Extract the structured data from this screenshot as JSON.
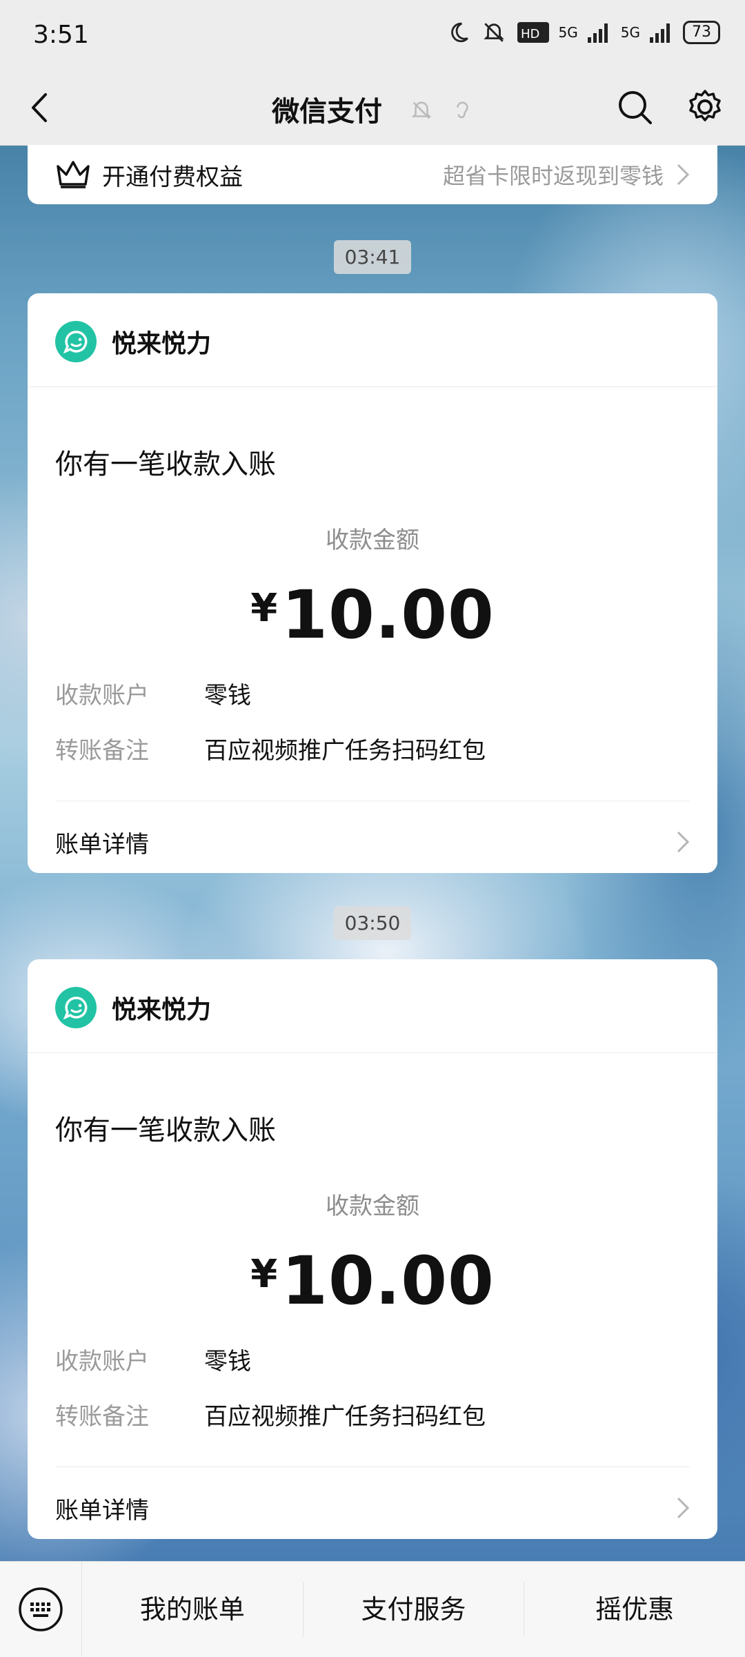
{
  "status_bar": {
    "time": "3:51",
    "network1": "5G",
    "network2": "5G",
    "battery": "73"
  },
  "nav": {
    "title": "微信支付"
  },
  "perk": {
    "label": "开通付费权益",
    "promo": "超省卡限时返现到零钱"
  },
  "messages": [
    {
      "timestamp": "03:41",
      "merchant": "悦来悦力",
      "headline": "你有一笔收款入账",
      "amount_label": "收款金额",
      "currency": "¥",
      "amount": "10.00",
      "account_label": "收款账户",
      "account_value": "零钱",
      "note_label": "转账备注",
      "note_value": "百应视频推广任务扫码红包",
      "detail_label": "账单详情"
    },
    {
      "timestamp": "03:50",
      "merchant": "悦来悦力",
      "headline": "你有一笔收款入账",
      "amount_label": "收款金额",
      "currency": "¥",
      "amount": "10.00",
      "account_label": "收款账户",
      "account_value": "零钱",
      "note_label": "转账备注",
      "note_value": "百应视频推广任务扫码红包",
      "detail_label": "账单详情"
    }
  ],
  "bottom_menu": [
    "我的账单",
    "支付服务",
    "摇优惠"
  ],
  "colors": {
    "brand": "#22c3a5",
    "bar_bg": "#ededed"
  }
}
